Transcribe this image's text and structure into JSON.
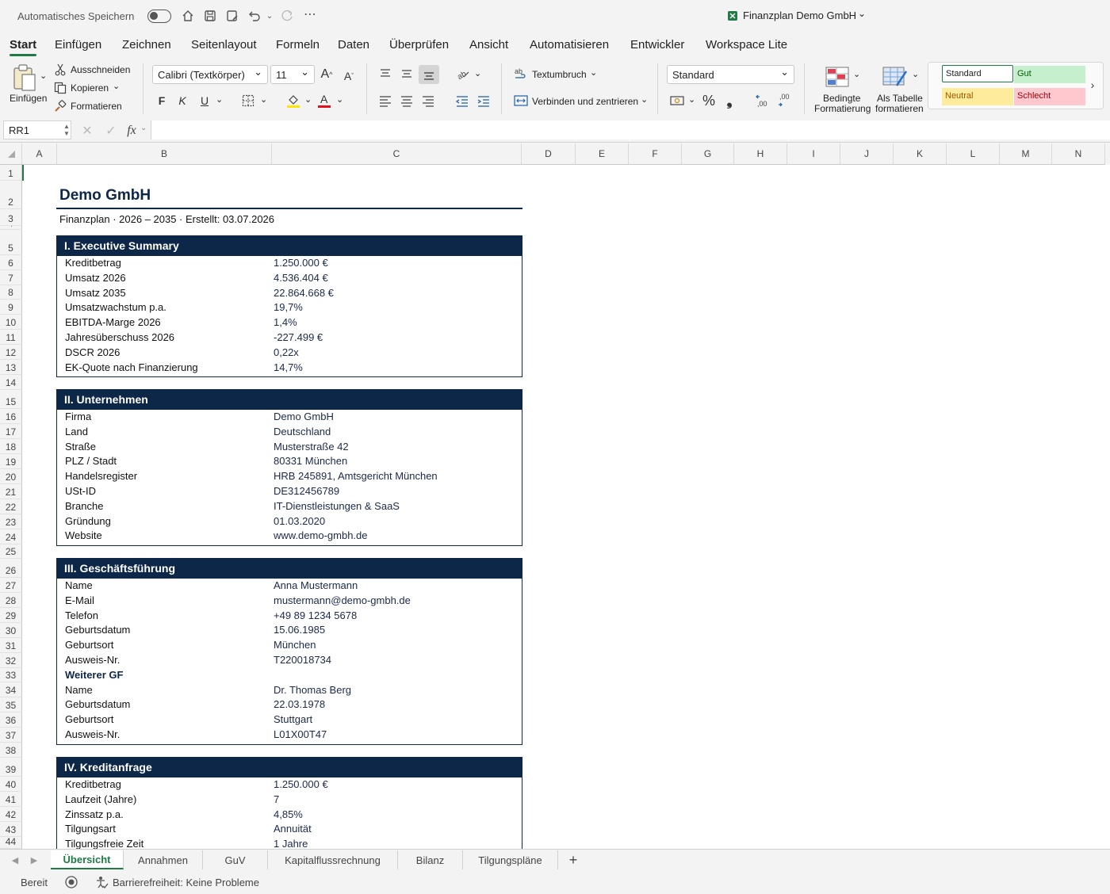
{
  "titlebar": {
    "autosave_label": "Automatisches Speichern",
    "doc_title": "Finanzplan Demo GmbH",
    "icons": [
      "home-icon",
      "save-icon",
      "save-as-icon",
      "undo-icon",
      "redo-icon",
      "more-icon"
    ]
  },
  "menu": [
    "Start",
    "Einfügen",
    "Zeichnen",
    "Seitenlayout",
    "Formeln",
    "Daten",
    "Überprüfen",
    "Ansicht",
    "Automatisieren",
    "Entwickler",
    "Workspace Lite"
  ],
  "ribbon": {
    "paste_label": "Einfügen",
    "cut_label": "Ausschneiden",
    "copy_label": "Kopieren",
    "format_painter_label": "Formatieren",
    "font_name": "Calibri (Textkörper)",
    "font_size": "11",
    "bold": "F",
    "italic": "K",
    "underline": "U",
    "wrap_label": "Textumbruch",
    "merge_label": "Verbinden und zentrieren",
    "number_format": "Standard",
    "percent": "%",
    "comma": "❟",
    "cond_format_label_1": "Bedingte",
    "cond_format_label_2": "Formatierung",
    "as_table_label_1": "Als Tabelle",
    "as_table_label_2": "formatieren",
    "styles": {
      "standard": "Standard",
      "gut": "Gut",
      "neutral": "Neutral",
      "schlecht": "Schlecht"
    },
    "colors": {
      "gut_bg": "#c6efce",
      "gut_fg": "#006100",
      "neutral_bg": "#ffeb9c",
      "neutral_fg": "#9c5700",
      "schlecht_bg": "#ffc7ce",
      "schlecht_fg": "#9c0006"
    }
  },
  "formula_bar": {
    "name_box": "RR1",
    "fx": "fx",
    "value": ""
  },
  "columns": [
    "A",
    "B",
    "C",
    "D",
    "E",
    "F",
    "G",
    "H",
    "I",
    "J",
    "K",
    "L",
    "M",
    "N"
  ],
  "sheet": {
    "company": "Demo GmbH",
    "subtitle": "Finanzplan  ·  2026 – 2035  ·  Erstellt: 03.07.2026",
    "sections": [
      {
        "title": "I. Executive Summary",
        "rows": [
          [
            "Kreditbetrag",
            "1.250.000 €"
          ],
          [
            "Umsatz 2026",
            "4.536.404 €"
          ],
          [
            "Umsatz 2035",
            "22.864.668 €"
          ],
          [
            "Umsatzwachstum p.a.",
            "19,7%"
          ],
          [
            "EBITDA-Marge 2026",
            "1,4%"
          ],
          [
            "Jahresüberschuss 2026",
            "-227.499 €"
          ],
          [
            "DSCR 2026",
            "0,22x"
          ],
          [
            "EK-Quote nach Finanzierung",
            "14,7%"
          ]
        ]
      },
      {
        "title": "II. Unternehmen",
        "rows": [
          [
            "Firma",
            "Demo GmbH"
          ],
          [
            "Land",
            "Deutschland"
          ],
          [
            "Straße",
            "Musterstraße 42"
          ],
          [
            "PLZ / Stadt",
            "80331 München"
          ],
          [
            "Handelsregister",
            "HRB 245891, Amtsgericht München"
          ],
          [
            "USt-ID",
            "DE312456789"
          ],
          [
            "Branche",
            "IT-Dienstleistungen & SaaS"
          ],
          [
            "Gründung",
            "01.03.2020"
          ],
          [
            "Website",
            "www.demo-gmbh.de"
          ]
        ]
      },
      {
        "title": "III. Geschäftsführung",
        "rows": [
          [
            "Name",
            "Anna Mustermann"
          ],
          [
            "E-Mail",
            "mustermann@demo-gmbh.de"
          ],
          [
            "Telefon",
            "+49 89 1234 5678"
          ],
          [
            "Geburtsdatum",
            "15.06.1985"
          ],
          [
            "Geburtsort",
            "München"
          ],
          [
            "Ausweis-Nr.",
            "T220018734"
          ],
          [
            "Weiterer GF",
            ""
          ],
          [
            "Name",
            "Dr. Thomas Berg"
          ],
          [
            "Geburtsdatum",
            "22.03.1978"
          ],
          [
            "Geburtsort",
            "Stuttgart"
          ],
          [
            "Ausweis-Nr.",
            "L01X00T47"
          ]
        ]
      },
      {
        "title": "IV. Kreditanfrage",
        "rows": [
          [
            "Kreditbetrag",
            "1.250.000 €"
          ],
          [
            "Laufzeit (Jahre)",
            "7"
          ],
          [
            "Zinssatz p.a.",
            "4,85%"
          ],
          [
            "Tilgungsart",
            "Annuität"
          ],
          [
            "Tilgungsfreie Zeit",
            "1 Jahre"
          ]
        ]
      }
    ]
  },
  "tabs": [
    "Übersicht",
    "Annahmen",
    "GuV",
    "Kapitalflussrechnung",
    "Bilanz",
    "Tilgungspläne"
  ],
  "add_tab": "+",
  "status": {
    "ready": "Bereit",
    "accessibility": "Barrierefreiheit: Keine Probleme"
  }
}
